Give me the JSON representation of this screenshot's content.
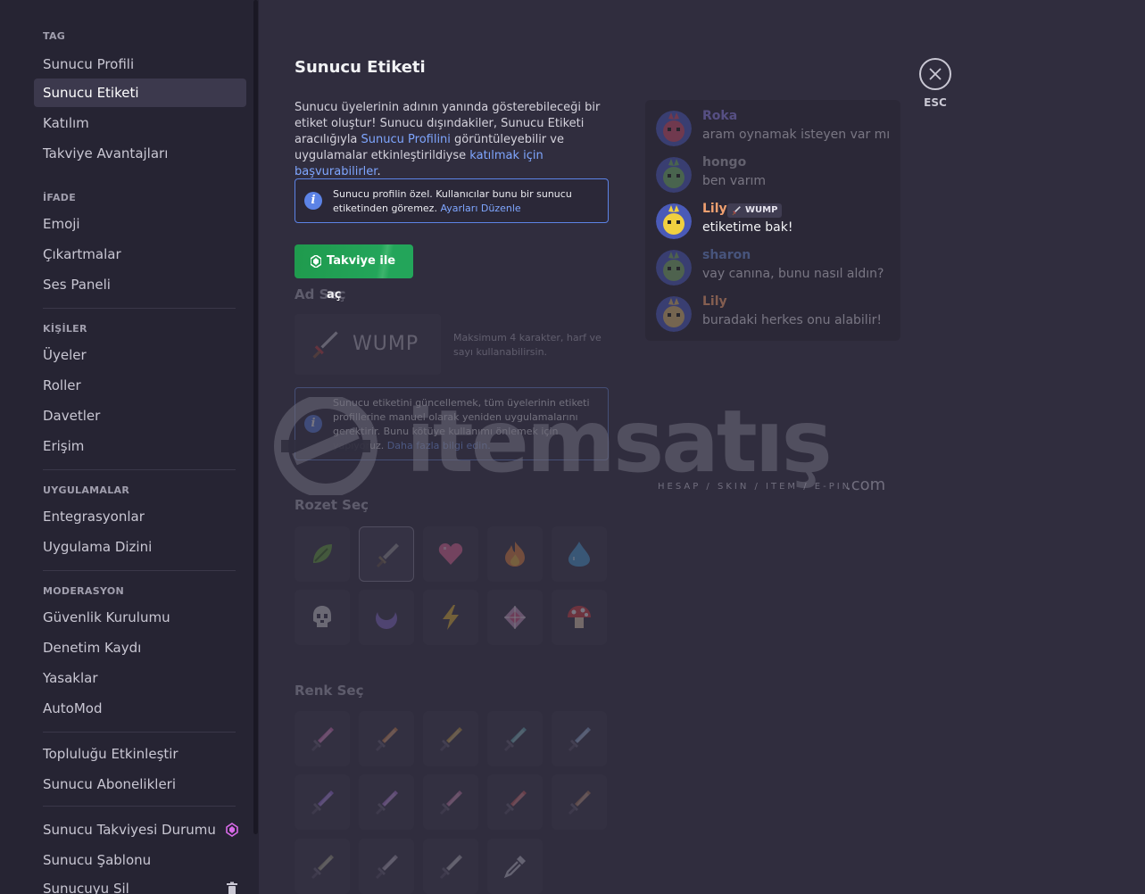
{
  "sidebar": {
    "sections": [
      {
        "header": "TAG",
        "items": [
          {
            "label": "Sunucu Profili"
          },
          {
            "label": "Sunucu Etiketi",
            "active": true
          },
          {
            "label": "Katılım"
          },
          {
            "label": "Takviye Avantajları"
          }
        ]
      },
      {
        "header": "İFADE",
        "items": [
          {
            "label": "Emoji"
          },
          {
            "label": "Çıkartmalar"
          },
          {
            "label": "Ses Paneli"
          }
        ]
      },
      {
        "header": "KİŞİLER",
        "items": [
          {
            "label": "Üyeler"
          },
          {
            "label": "Roller"
          },
          {
            "label": "Davetler"
          },
          {
            "label": "Erişim"
          }
        ]
      },
      {
        "header": "UYGULAMALAR",
        "items": [
          {
            "label": "Entegrasyonlar"
          },
          {
            "label": "Uygulama Dizini"
          }
        ]
      },
      {
        "header": "MODERASYON",
        "items": [
          {
            "label": "Güvenlik Kurulumu"
          },
          {
            "label": "Denetim Kaydı"
          },
          {
            "label": "Yasaklar"
          },
          {
            "label": "AutoMod"
          }
        ]
      },
      {
        "header": "",
        "items": [
          {
            "label": "Topluluğu Etkinleştir"
          },
          {
            "label": "Sunucu Abonelikleri"
          }
        ]
      },
      {
        "header": "",
        "items": [
          {
            "label": "Sunucu Takviyesi Durumu",
            "icon": "boost-gem-icon"
          },
          {
            "label": "Sunucu Şablonu"
          },
          {
            "label": "Sunucuyu Sil",
            "icon": "trash-icon"
          }
        ]
      }
    ]
  },
  "main": {
    "title": "Sunucu Etiketi",
    "desc_1": "Sunucu üyelerinin adının yanında gösterebileceği bir etiket oluştur! Sunucu dışındakiler, Sunucu Etiketi aracılığıyla ",
    "desc_link_1": "Sunucu Profilini",
    "desc_2": " görüntüleyebilir ve uygulamalar etkinleştirildiyse ",
    "desc_link_2": "katılmak için başvurabilirler",
    "desc_3": ".",
    "info_text": "Sunucu profilin özel. Kullanıcılar bunu bir sunucu etiketinden göremez. ",
    "info_link": "Ayarları Düzenle",
    "boost_button": "Takviye ile aç",
    "name_label": "Ad Seç",
    "name_value": "WUMP",
    "name_hint": "Maksimum 4 karakter, harf ve sayı kullanabilirsin.",
    "info2_text": "Sunucu etiketini güncellemek, tüm üyelerinin etiketi profillerine manuel olarak yeniden uygulamalarını gerektirir. Bunu kötüye kullanımı önlemek için yapıyoruz. ",
    "info2_link": "Daha fazla bilgi edin.",
    "badge_label": "Rozet Seç",
    "color_label": "Renk Seç"
  },
  "badges": [
    {
      "name": "leaf-badge",
      "color": "#6bab3c"
    },
    {
      "name": "sword-badge",
      "color": "#a0a0a0",
      "selected": true
    },
    {
      "name": "heart-badge",
      "color": "#f06e9c"
    },
    {
      "name": "fire-badge",
      "color": "#f08a3c"
    },
    {
      "name": "water-drop-badge",
      "color": "#4aa6e0"
    },
    {
      "name": "skull-badge",
      "color": "#d8d8d8"
    },
    {
      "name": "moon-badge",
      "color": "#8a6fd0"
    },
    {
      "name": "lightning-badge",
      "color": "#f0c030"
    },
    {
      "name": "diamond-badge",
      "color": "#e05a8a"
    },
    {
      "name": "mushroom-badge",
      "color": "#e04040"
    }
  ],
  "colors": [
    {
      "name": "pink-sword",
      "color": "#d46fb8"
    },
    {
      "name": "orange-sword",
      "color": "#d48a4c"
    },
    {
      "name": "gold-sword",
      "color": "#c8a040"
    },
    {
      "name": "teal-sword",
      "color": "#6ab0b8"
    },
    {
      "name": "blue-sword",
      "color": "#8aa8d0"
    },
    {
      "name": "violet-sword",
      "color": "#9a6fe0"
    },
    {
      "name": "purple-sword",
      "color": "#b07ad8"
    },
    {
      "name": "mauve-sword",
      "color": "#c87aa8"
    },
    {
      "name": "red-sword",
      "color": "#d06060"
    },
    {
      "name": "brown-sword",
      "color": "#b08060"
    },
    {
      "name": "olive-sword",
      "color": "#a0a080"
    },
    {
      "name": "grey-sword",
      "color": "#a8a0b0"
    },
    {
      "name": "silver-sword",
      "color": "#b0b0b8"
    }
  ],
  "eyedropper_icon": "eyedropper-icon",
  "chat": [
    {
      "user": "Roka",
      "text": "aram oynamak isteyen var mı",
      "name_color": "#8a7fe0",
      "avatar": "#c44e6a",
      "faded": true
    },
    {
      "user": "hongo",
      "text": "ben varım",
      "name_color": "#a8a6b2",
      "avatar": "#6fae6a",
      "faded": true
    },
    {
      "user": "Lily",
      "text": "etiketime bak!",
      "name_color": "#f0a070",
      "avatar": "#f0d040",
      "tag": "WUMP",
      "faded": false
    },
    {
      "user": "sharon",
      "text": "vay canına, bunu nasıl aldın?",
      "name_color": "#6a8ad0",
      "avatar": "#7aaa6a",
      "faded": true
    },
    {
      "user": "Lily",
      "text": "buradaki herkes onu alabilir!",
      "name_color": "#f0a070",
      "avatar": "#d0b070",
      "faded": true
    }
  ],
  "close": {
    "label": "ESC"
  },
  "watermark": {
    "text": "itemsatış",
    "sub": "HESAP / SKIN / ITEM / E-PIN",
    "tld": ".com"
  },
  "accent": {
    "link": "#7fa6ff",
    "green": "#23a55a",
    "info_border": "#5c83e6",
    "boost_pink": "#d86ae8"
  }
}
